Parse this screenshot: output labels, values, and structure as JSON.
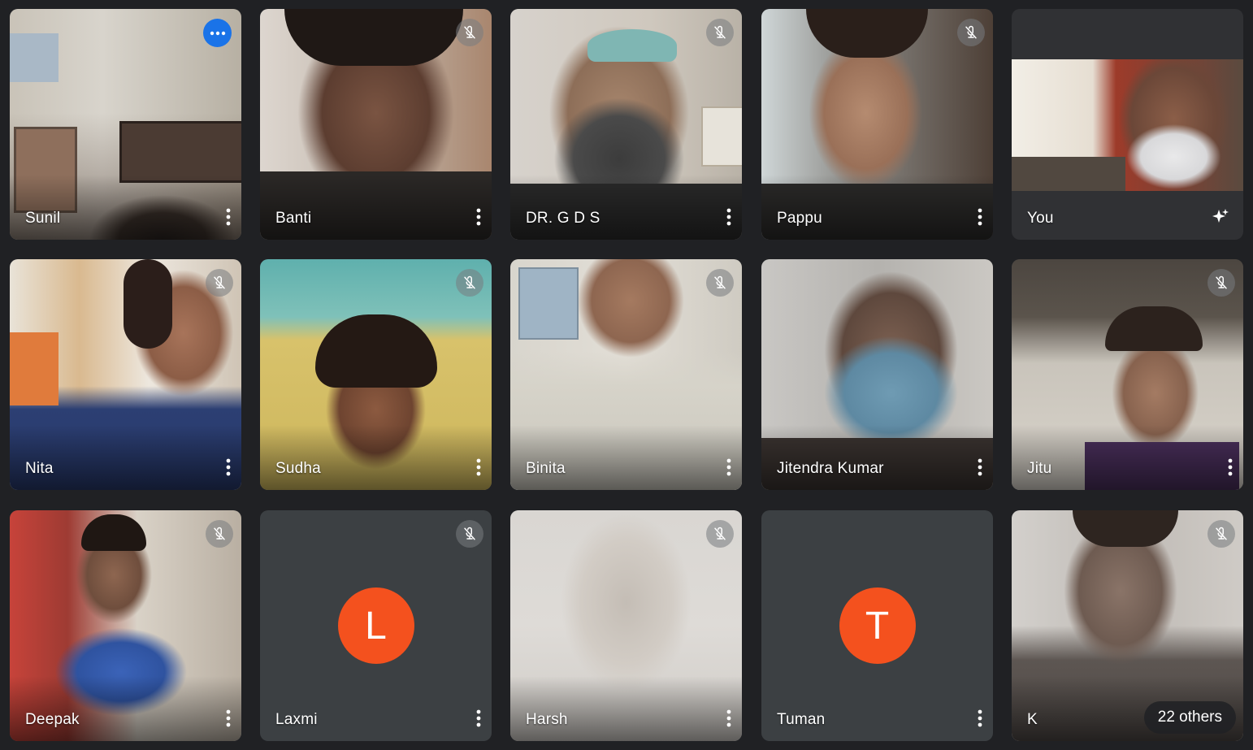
{
  "participants": [
    {
      "name": "Sunil",
      "status": "speaking",
      "indicator_icon": "more-horizontal-icon"
    },
    {
      "name": "Banti",
      "status": "muted",
      "indicator_icon": "mic-off-icon"
    },
    {
      "name": "DR. G D S",
      "status": "muted",
      "indicator_icon": "mic-off-icon"
    },
    {
      "name": "Pappu",
      "status": "muted",
      "indicator_icon": "mic-off-icon"
    },
    {
      "name": "You",
      "status": "self",
      "indicator_icon": "sparkle-effects-icon"
    },
    {
      "name": "Nita",
      "status": "muted",
      "indicator_icon": "mic-off-icon"
    },
    {
      "name": "Sudha",
      "status": "muted",
      "indicator_icon": "mic-off-icon"
    },
    {
      "name": "Binita",
      "status": "muted",
      "indicator_icon": "mic-off-icon"
    },
    {
      "name": "Jitendra Kumar",
      "status": "unmuted"
    },
    {
      "name": "Jitu",
      "status": "muted",
      "indicator_icon": "mic-off-icon"
    },
    {
      "name": "Deepak",
      "status": "muted",
      "indicator_icon": "mic-off-icon"
    },
    {
      "name": "Laxmi",
      "status": "muted",
      "indicator_icon": "mic-off-icon",
      "avatar_letter": "L"
    },
    {
      "name": "Harsh",
      "status": "muted",
      "indicator_icon": "mic-off-icon"
    },
    {
      "name": "Tuman",
      "status": "unmuted",
      "avatar_letter": "T"
    },
    {
      "name": "K",
      "status": "muted",
      "indicator_icon": "mic-off-icon"
    }
  ],
  "others_label": "22 others",
  "colors": {
    "background": "#202124",
    "avatar": "#f4511e",
    "speaking": "#1a73e8"
  }
}
